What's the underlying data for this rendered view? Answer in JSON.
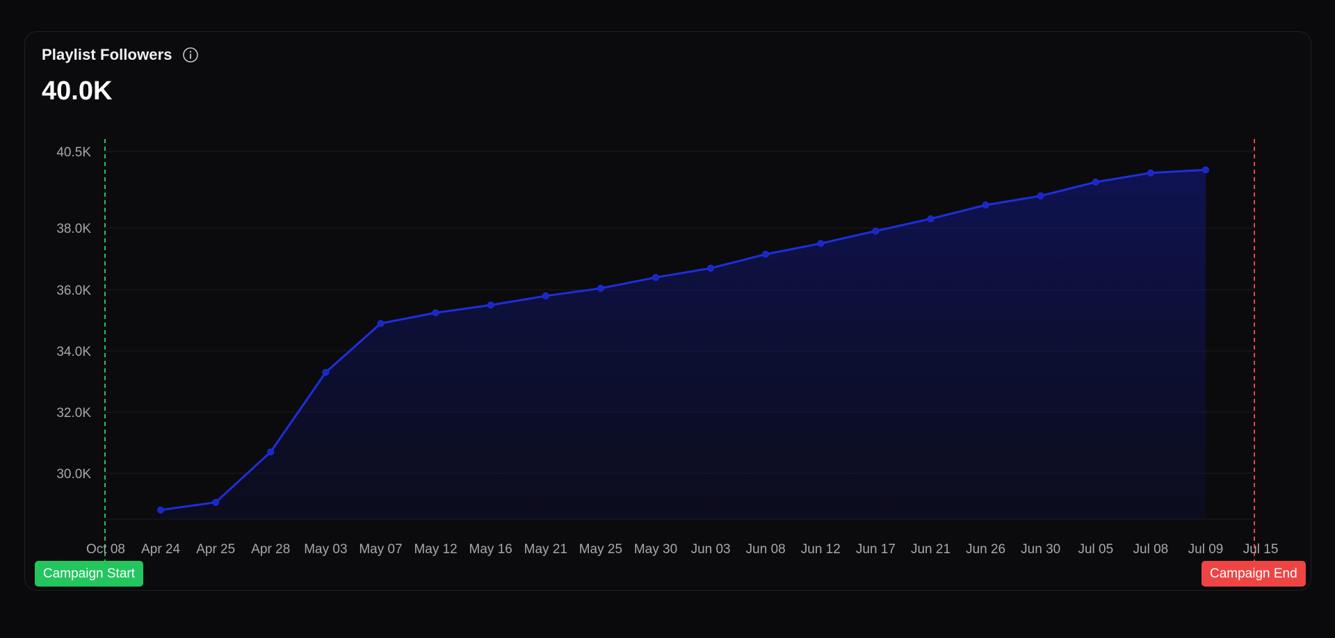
{
  "card": {
    "title": "Playlist Followers",
    "value": "40.0K"
  },
  "markers": {
    "start_label": "Campaign Start",
    "end_label": "Campaign End",
    "start_color": "#22c55e",
    "end_color": "#ef4444"
  },
  "colors": {
    "line": "#1e2ee0",
    "background": "#0a0a0c"
  },
  "chart_data": {
    "type": "area",
    "title": "Playlist Followers",
    "xlabel": "",
    "ylabel": "",
    "x_ticks": [
      "Oct 08",
      "Apr 24",
      "Apr 25",
      "Apr 28",
      "May 03",
      "May 07",
      "May 12",
      "May 16",
      "May 21",
      "May 25",
      "May 30",
      "Jun 03",
      "Jun 08",
      "Jun 12",
      "Jun 17",
      "Jun 21",
      "Jun 26",
      "Jun 30",
      "Jul 05",
      "Jul 08",
      "Jul 09",
      "Jul 15"
    ],
    "y_ticks": [
      "30.0K",
      "32.0K",
      "34.0K",
      "36.0K",
      "38.0K",
      "40.5K"
    ],
    "y_tick_values": [
      30000,
      32000,
      34000,
      36000,
      38000,
      40500
    ],
    "ylim": [
      28500,
      40500
    ],
    "grid": true,
    "series": [
      {
        "x": [
          "Apr 24",
          "Apr 25",
          "Apr 28",
          "May 03",
          "May 07",
          "May 12",
          "May 16",
          "May 21",
          "May 25",
          "May 30",
          "Jun 03",
          "Jun 08",
          "Jun 12",
          "Jun 17",
          "Jun 21",
          "Jun 26",
          "Jun 30",
          "Jul 05",
          "Jul 08",
          "Jul 09"
        ],
        "values": [
          28800,
          29050,
          30700,
          33300,
          34900,
          35250,
          35500,
          35800,
          36050,
          36400,
          36700,
          37150,
          37500,
          37900,
          38300,
          38750,
          39050,
          39500,
          39800,
          39900
        ]
      }
    ],
    "annotations": [
      {
        "x": "Oct 08",
        "label": "Campaign Start",
        "style": "dashed",
        "color": "#22c55e"
      },
      {
        "x": "Jul 15",
        "label": "Campaign End",
        "style": "dashed",
        "color": "#ef4444"
      }
    ]
  }
}
